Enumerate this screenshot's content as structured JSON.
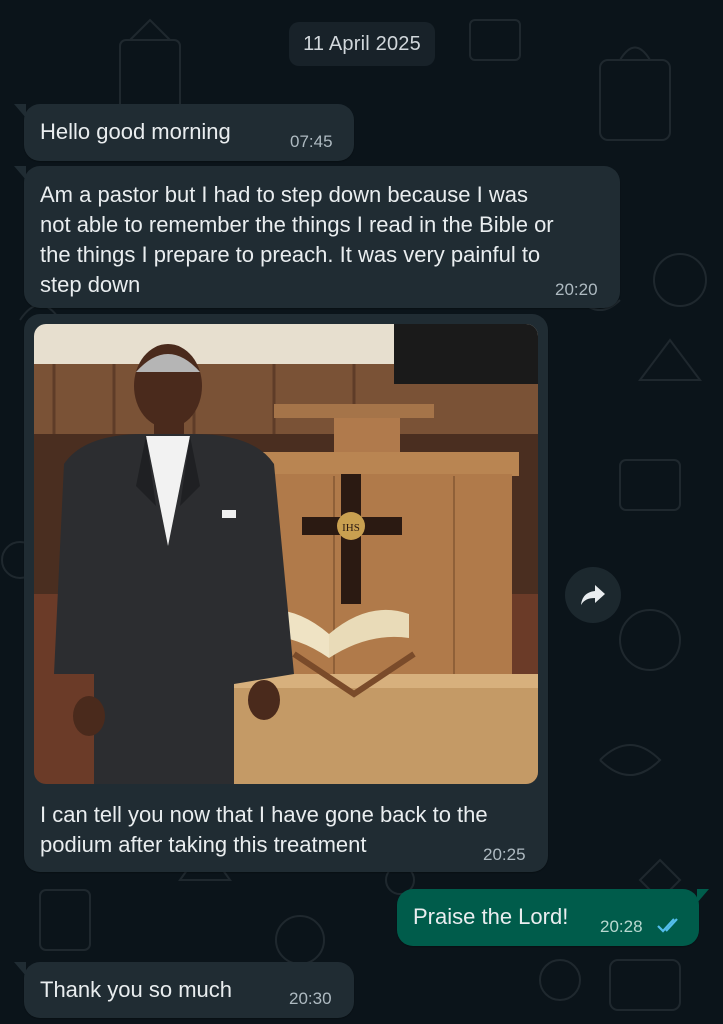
{
  "chat": {
    "date_separator": "11 April 2025",
    "messages": [
      {
        "direction": "incoming",
        "text": "Hello good morning",
        "time": "07:45"
      },
      {
        "direction": "incoming",
        "text": "Am a pastor but I had to step down because I was\nnot able to remember the things I read in the Bible or\nthe things I prepare to preach. It was very painful to\nstep down",
        "time": "20:20"
      },
      {
        "direction": "incoming",
        "type": "image",
        "image_description": "man in suit standing beside a wooden pulpit with a cross and an open Bible",
        "image_label": "IHS",
        "text": "I can tell you now that I have gone back to the\npodium after taking this treatment",
        "time": "20:25"
      },
      {
        "direction": "outgoing",
        "text": "Praise the Lord!",
        "time": "20:28",
        "status": "read"
      },
      {
        "direction": "incoming",
        "text": "Thank you so much",
        "time": "20:30"
      }
    ]
  },
  "icons": {
    "forward": "forward-arrow-icon",
    "read_receipt": "double-check-icon"
  },
  "colors": {
    "background": "#0b141a",
    "incoming_bubble": "#202c33",
    "outgoing_bubble": "#005c4b",
    "read_tick": "#53bdeb"
  }
}
